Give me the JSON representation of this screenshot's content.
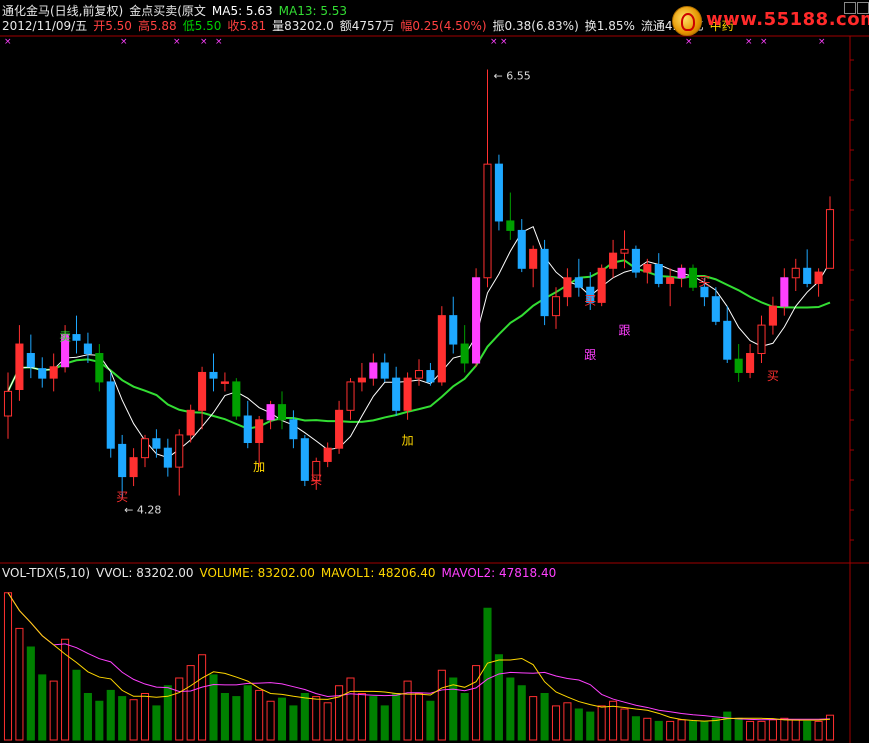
{
  "header": {
    "line1": [
      {
        "text": "通化金马(日线,前复权)",
        "color": "#e8e8e8"
      },
      {
        "text": "金点买卖(原文",
        "color": "#e8e8e8"
      },
      {
        "text": "MA5: 5.63",
        "color": "#ffffff"
      },
      {
        "text": "MA13: 5.53",
        "color": "#33dd33"
      }
    ],
    "line2": [
      {
        "text": "2012/11/09/五",
        "color": "#e8e8e8"
      },
      {
        "text": "开5.50",
        "color": "#ff4040"
      },
      {
        "text": "高5.88",
        "color": "#ff4040"
      },
      {
        "text": "低5.50",
        "color": "#00d000"
      },
      {
        "text": "收5.81",
        "color": "#ff4040"
      },
      {
        "text": "量83202.0",
        "color": "#e8e8e8"
      },
      {
        "text": "额4757万",
        "color": "#e8e8e8"
      },
      {
        "text": "幅0.25(4.50%)",
        "color": "#ff4040"
      },
      {
        "text": "振0.38(6.83%)",
        "color": "#e8e8e8"
      },
      {
        "text": "换1.85%",
        "color": "#e8e8e8"
      },
      {
        "text": "流通4.49亿",
        "color": "#e8e8e8"
      },
      {
        "text": "中药",
        "color": "#ffd700"
      }
    ]
  },
  "logo": {
    "text": "www.55188.com"
  },
  "volume_header": [
    {
      "text": "VOL-TDX(5,10)",
      "color": "#e8e8e8"
    },
    {
      "text": "VVOL: 83202.00",
      "color": "#e8e8e8"
    },
    {
      "text": "VOLUME: 83202.00",
      "color": "#ffd700"
    },
    {
      "text": "MAVOL1: 48206.40",
      "color": "#ffd700"
    },
    {
      "text": "MAVOL2: 47818.40",
      "color": "#ff40ff"
    }
  ],
  "chart_data": {
    "type": "candlestick",
    "high_label": "6.55",
    "low_label": "4.28",
    "annotations": [
      {
        "text": "卖",
        "color": "#33dd33",
        "index": 5,
        "price": 5.12
      },
      {
        "text": "加",
        "color": "#ffd700",
        "index": 22,
        "price": 4.43
      },
      {
        "text": "买",
        "color": "#ff3030",
        "index": 10,
        "price": 4.27
      },
      {
        "text": "买",
        "color": "#ff3030",
        "index": 27,
        "price": 4.36
      },
      {
        "text": "加",
        "color": "#ffd700",
        "index": 35,
        "price": 4.57
      },
      {
        "text": "买",
        "color": "#ff3030",
        "index": 51,
        "price": 5.31
      },
      {
        "text": "跟",
        "color": "#ff40ff",
        "index": 51,
        "price": 5.02
      },
      {
        "text": "跟",
        "color": "#ff40ff",
        "index": 54,
        "price": 5.15
      },
      {
        "text": "买",
        "color": "#ff3030",
        "index": 61,
        "price": 5.41
      },
      {
        "text": "买",
        "color": "#ff3030",
        "index": 67,
        "price": 4.91
      }
    ],
    "candles": [
      [
        4.72,
        4.95,
        4.6,
        4.85
      ],
      [
        4.86,
        5.2,
        4.8,
        5.1
      ],
      [
        5.05,
        5.15,
        4.92,
        4.98
      ],
      [
        4.97,
        5.03,
        4.87,
        4.92
      ],
      [
        4.92,
        5.05,
        4.85,
        4.98
      ],
      [
        4.98,
        5.2,
        4.95,
        5.15
      ],
      [
        5.15,
        5.25,
        5.05,
        5.12
      ],
      [
        5.1,
        5.16,
        5.0,
        5.05
      ],
      [
        5.05,
        5.1,
        4.85,
        4.9
      ],
      [
        4.9,
        4.95,
        4.5,
        4.55
      ],
      [
        4.57,
        4.62,
        4.28,
        4.4
      ],
      [
        4.4,
        4.55,
        4.35,
        4.5
      ],
      [
        4.5,
        4.62,
        4.45,
        4.6
      ],
      [
        4.6,
        4.65,
        4.5,
        4.55
      ],
      [
        4.55,
        4.6,
        4.4,
        4.45
      ],
      [
        4.45,
        4.65,
        4.3,
        4.62
      ],
      [
        4.62,
        4.78,
        4.58,
        4.75
      ],
      [
        4.75,
        4.98,
        4.65,
        4.95
      ],
      [
        4.95,
        5.05,
        4.85,
        4.92
      ],
      [
        4.9,
        4.95,
        4.85,
        4.9
      ],
      [
        4.9,
        4.92,
        4.7,
        4.72
      ],
      [
        4.72,
        4.8,
        4.55,
        4.58
      ],
      [
        4.58,
        4.72,
        4.45,
        4.7
      ],
      [
        4.7,
        4.8,
        4.65,
        4.78
      ],
      [
        4.78,
        4.85,
        4.65,
        4.7
      ],
      [
        4.7,
        4.75,
        4.55,
        4.6
      ],
      [
        4.6,
        4.62,
        4.35,
        4.38
      ],
      [
        4.38,
        4.5,
        4.33,
        4.48
      ],
      [
        4.48,
        4.58,
        4.45,
        4.55
      ],
      [
        4.55,
        4.8,
        4.52,
        4.75
      ],
      [
        4.75,
        4.92,
        4.7,
        4.9
      ],
      [
        4.9,
        5.0,
        4.85,
        4.92
      ],
      [
        4.92,
        5.05,
        4.88,
        5.0
      ],
      [
        5.0,
        5.05,
        4.9,
        4.92
      ],
      [
        4.92,
        4.98,
        4.72,
        4.75
      ],
      [
        4.75,
        4.95,
        4.7,
        4.92
      ],
      [
        4.92,
        5.02,
        4.88,
        4.96
      ],
      [
        4.96,
        5.0,
        4.88,
        4.9
      ],
      [
        4.9,
        5.3,
        4.88,
        5.25
      ],
      [
        5.25,
        5.35,
        5.05,
        5.1
      ],
      [
        5.1,
        5.2,
        4.95,
        5.0
      ],
      [
        5.0,
        5.5,
        4.98,
        5.45
      ],
      [
        5.45,
        6.55,
        5.4,
        6.05
      ],
      [
        6.05,
        6.1,
        5.7,
        5.75
      ],
      [
        5.75,
        5.9,
        5.65,
        5.7
      ],
      [
        5.7,
        5.76,
        5.48,
        5.5
      ],
      [
        5.5,
        5.62,
        5.4,
        5.6
      ],
      [
        5.6,
        5.65,
        5.2,
        5.25
      ],
      [
        5.25,
        5.4,
        5.18,
        5.35
      ],
      [
        5.35,
        5.5,
        5.3,
        5.45
      ],
      [
        5.45,
        5.55,
        5.35,
        5.4
      ],
      [
        5.4,
        5.48,
        5.28,
        5.32
      ],
      [
        5.32,
        5.52,
        5.3,
        5.5
      ],
      [
        5.5,
        5.65,
        5.45,
        5.58
      ],
      [
        5.58,
        5.7,
        5.5,
        5.6
      ],
      [
        5.6,
        5.62,
        5.45,
        5.48
      ],
      [
        5.48,
        5.55,
        5.42,
        5.52
      ],
      [
        5.52,
        5.58,
        5.4,
        5.42
      ],
      [
        5.42,
        5.5,
        5.3,
        5.45
      ],
      [
        5.45,
        5.52,
        5.4,
        5.5
      ],
      [
        5.5,
        5.52,
        5.38,
        5.4
      ],
      [
        5.4,
        5.45,
        5.3,
        5.35
      ],
      [
        5.35,
        5.4,
        5.2,
        5.22
      ],
      [
        5.22,
        5.3,
        5.0,
        5.02
      ],
      [
        5.02,
        5.1,
        4.9,
        4.95
      ],
      [
        4.95,
        5.1,
        4.92,
        5.05
      ],
      [
        5.05,
        5.25,
        5.0,
        5.2
      ],
      [
        5.2,
        5.35,
        5.15,
        5.3
      ],
      [
        5.3,
        5.5,
        5.25,
        5.45
      ],
      [
        5.45,
        5.55,
        5.38,
        5.5
      ],
      [
        5.5,
        5.6,
        5.4,
        5.42
      ],
      [
        5.42,
        5.5,
        5.35,
        5.48
      ],
      [
        5.5,
        5.88,
        5.5,
        5.81
      ]
    ],
    "volume": [
      [
        95000,
        "up"
      ],
      [
        72000,
        "up"
      ],
      [
        60000,
        "down"
      ],
      [
        42000,
        "down"
      ],
      [
        38000,
        "up"
      ],
      [
        65000,
        "up"
      ],
      [
        45000,
        "down"
      ],
      [
        30000,
        "down"
      ],
      [
        25000,
        "down"
      ],
      [
        32000,
        "down"
      ],
      [
        28000,
        "down"
      ],
      [
        26000,
        "up"
      ],
      [
        30000,
        "up"
      ],
      [
        22000,
        "down"
      ],
      [
        35000,
        "down"
      ],
      [
        40000,
        "up"
      ],
      [
        48000,
        "up"
      ],
      [
        55000,
        "up"
      ],
      [
        42000,
        "down"
      ],
      [
        30000,
        "down"
      ],
      [
        28000,
        "down"
      ],
      [
        35000,
        "down"
      ],
      [
        32000,
        "up"
      ],
      [
        25000,
        "up"
      ],
      [
        27000,
        "down"
      ],
      [
        22000,
        "down"
      ],
      [
        30000,
        "down"
      ],
      [
        28000,
        "up"
      ],
      [
        24000,
        "up"
      ],
      [
        35000,
        "up"
      ],
      [
        40000,
        "up"
      ],
      [
        30000,
        "up"
      ],
      [
        28000,
        "down"
      ],
      [
        22000,
        "down"
      ],
      [
        30000,
        "down"
      ],
      [
        38000,
        "up"
      ],
      [
        30000,
        "up"
      ],
      [
        25000,
        "down"
      ],
      [
        45000,
        "up"
      ],
      [
        40000,
        "down"
      ],
      [
        30000,
        "down"
      ],
      [
        48000,
        "up"
      ],
      [
        85000,
        "down"
      ],
      [
        55000,
        "down"
      ],
      [
        40000,
        "down"
      ],
      [
        35000,
        "down"
      ],
      [
        28000,
        "up"
      ],
      [
        30000,
        "down"
      ],
      [
        22000,
        "up"
      ],
      [
        24000,
        "up"
      ],
      [
        20000,
        "down"
      ],
      [
        18000,
        "down"
      ],
      [
        22000,
        "up"
      ],
      [
        25000,
        "up"
      ],
      [
        20000,
        "up"
      ],
      [
        15000,
        "down"
      ],
      [
        14000,
        "up"
      ],
      [
        12000,
        "down"
      ],
      [
        12000,
        "up"
      ],
      [
        13000,
        "up"
      ],
      [
        12000,
        "down"
      ],
      [
        12000,
        "down"
      ],
      [
        14000,
        "down"
      ],
      [
        18000,
        "down"
      ],
      [
        14000,
        "down"
      ],
      [
        12000,
        "up"
      ],
      [
        12000,
        "up"
      ],
      [
        13000,
        "up"
      ],
      [
        14000,
        "up"
      ],
      [
        13000,
        "up"
      ],
      [
        12000,
        "down"
      ],
      [
        12000,
        "up"
      ],
      [
        16000,
        "up"
      ]
    ],
    "ma": [
      {
        "name": "MA5",
        "color": "#ffffff"
      },
      {
        "name": "MA13",
        "color": "#33dd33"
      }
    ],
    "vol_ma": [
      {
        "name": "MAVOL1",
        "color": "#ffd700"
      },
      {
        "name": "MAVOL2",
        "color": "#ff40ff"
      }
    ]
  },
  "colors": {
    "up": "#ff3030",
    "down_blue": "#1ea8ff",
    "down_green": "#00a000",
    "grid": "#800000",
    "axis": "#a00000"
  }
}
